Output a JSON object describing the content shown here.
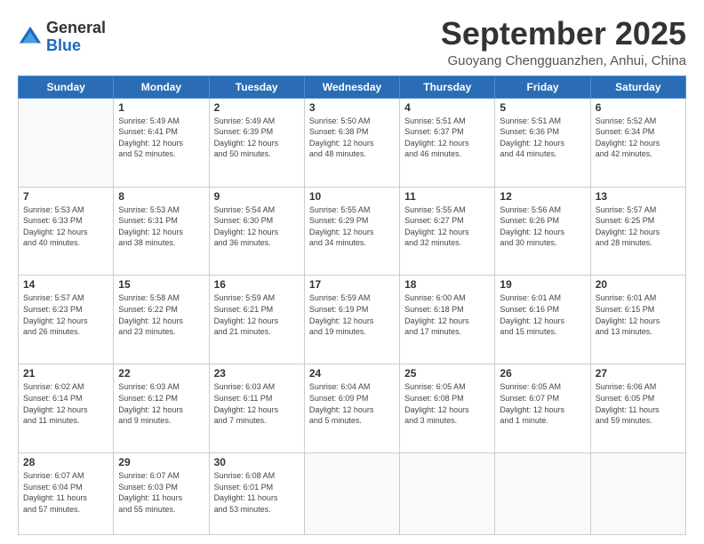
{
  "header": {
    "logo_line1": "General",
    "logo_line2": "Blue",
    "month": "September 2025",
    "location": "Guoyang Chengguanzhen, Anhui, China"
  },
  "weekdays": [
    "Sunday",
    "Monday",
    "Tuesday",
    "Wednesday",
    "Thursday",
    "Friday",
    "Saturday"
  ],
  "weeks": [
    [
      {
        "day": "",
        "info": ""
      },
      {
        "day": "1",
        "info": "Sunrise: 5:49 AM\nSunset: 6:41 PM\nDaylight: 12 hours\nand 52 minutes."
      },
      {
        "day": "2",
        "info": "Sunrise: 5:49 AM\nSunset: 6:39 PM\nDaylight: 12 hours\nand 50 minutes."
      },
      {
        "day": "3",
        "info": "Sunrise: 5:50 AM\nSunset: 6:38 PM\nDaylight: 12 hours\nand 48 minutes."
      },
      {
        "day": "4",
        "info": "Sunrise: 5:51 AM\nSunset: 6:37 PM\nDaylight: 12 hours\nand 46 minutes."
      },
      {
        "day": "5",
        "info": "Sunrise: 5:51 AM\nSunset: 6:36 PM\nDaylight: 12 hours\nand 44 minutes."
      },
      {
        "day": "6",
        "info": "Sunrise: 5:52 AM\nSunset: 6:34 PM\nDaylight: 12 hours\nand 42 minutes."
      }
    ],
    [
      {
        "day": "7",
        "info": "Sunrise: 5:53 AM\nSunset: 6:33 PM\nDaylight: 12 hours\nand 40 minutes."
      },
      {
        "day": "8",
        "info": "Sunrise: 5:53 AM\nSunset: 6:31 PM\nDaylight: 12 hours\nand 38 minutes."
      },
      {
        "day": "9",
        "info": "Sunrise: 5:54 AM\nSunset: 6:30 PM\nDaylight: 12 hours\nand 36 minutes."
      },
      {
        "day": "10",
        "info": "Sunrise: 5:55 AM\nSunset: 6:29 PM\nDaylight: 12 hours\nand 34 minutes."
      },
      {
        "day": "11",
        "info": "Sunrise: 5:55 AM\nSunset: 6:27 PM\nDaylight: 12 hours\nand 32 minutes."
      },
      {
        "day": "12",
        "info": "Sunrise: 5:56 AM\nSunset: 6:26 PM\nDaylight: 12 hours\nand 30 minutes."
      },
      {
        "day": "13",
        "info": "Sunrise: 5:57 AM\nSunset: 6:25 PM\nDaylight: 12 hours\nand 28 minutes."
      }
    ],
    [
      {
        "day": "14",
        "info": "Sunrise: 5:57 AM\nSunset: 6:23 PM\nDaylight: 12 hours\nand 26 minutes."
      },
      {
        "day": "15",
        "info": "Sunrise: 5:58 AM\nSunset: 6:22 PM\nDaylight: 12 hours\nand 23 minutes."
      },
      {
        "day": "16",
        "info": "Sunrise: 5:59 AM\nSunset: 6:21 PM\nDaylight: 12 hours\nand 21 minutes."
      },
      {
        "day": "17",
        "info": "Sunrise: 5:59 AM\nSunset: 6:19 PM\nDaylight: 12 hours\nand 19 minutes."
      },
      {
        "day": "18",
        "info": "Sunrise: 6:00 AM\nSunset: 6:18 PM\nDaylight: 12 hours\nand 17 minutes."
      },
      {
        "day": "19",
        "info": "Sunrise: 6:01 AM\nSunset: 6:16 PM\nDaylight: 12 hours\nand 15 minutes."
      },
      {
        "day": "20",
        "info": "Sunrise: 6:01 AM\nSunset: 6:15 PM\nDaylight: 12 hours\nand 13 minutes."
      }
    ],
    [
      {
        "day": "21",
        "info": "Sunrise: 6:02 AM\nSunset: 6:14 PM\nDaylight: 12 hours\nand 11 minutes."
      },
      {
        "day": "22",
        "info": "Sunrise: 6:03 AM\nSunset: 6:12 PM\nDaylight: 12 hours\nand 9 minutes."
      },
      {
        "day": "23",
        "info": "Sunrise: 6:03 AM\nSunset: 6:11 PM\nDaylight: 12 hours\nand 7 minutes."
      },
      {
        "day": "24",
        "info": "Sunrise: 6:04 AM\nSunset: 6:09 PM\nDaylight: 12 hours\nand 5 minutes."
      },
      {
        "day": "25",
        "info": "Sunrise: 6:05 AM\nSunset: 6:08 PM\nDaylight: 12 hours\nand 3 minutes."
      },
      {
        "day": "26",
        "info": "Sunrise: 6:05 AM\nSunset: 6:07 PM\nDaylight: 12 hours\nand 1 minute."
      },
      {
        "day": "27",
        "info": "Sunrise: 6:06 AM\nSunset: 6:05 PM\nDaylight: 11 hours\nand 59 minutes."
      }
    ],
    [
      {
        "day": "28",
        "info": "Sunrise: 6:07 AM\nSunset: 6:04 PM\nDaylight: 11 hours\nand 57 minutes."
      },
      {
        "day": "29",
        "info": "Sunrise: 6:07 AM\nSunset: 6:03 PM\nDaylight: 11 hours\nand 55 minutes."
      },
      {
        "day": "30",
        "info": "Sunrise: 6:08 AM\nSunset: 6:01 PM\nDaylight: 11 hours\nand 53 minutes."
      },
      {
        "day": "",
        "info": ""
      },
      {
        "day": "",
        "info": ""
      },
      {
        "day": "",
        "info": ""
      },
      {
        "day": "",
        "info": ""
      }
    ]
  ]
}
